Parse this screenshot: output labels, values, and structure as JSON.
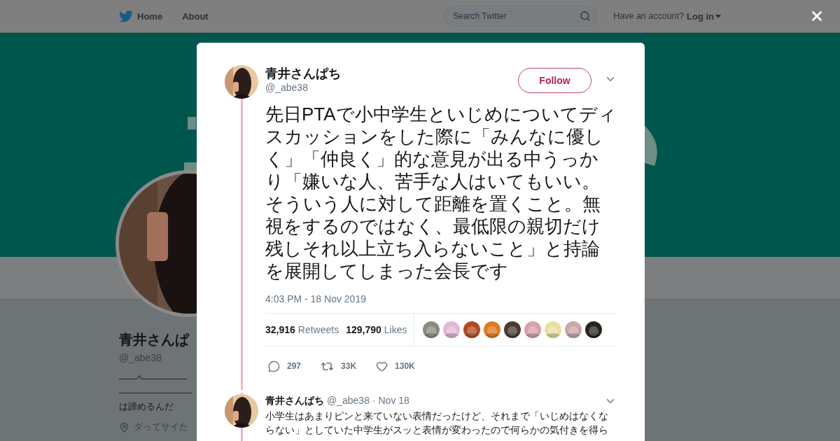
{
  "header": {
    "nav": [
      {
        "label": "Home"
      },
      {
        "label": "About"
      }
    ],
    "search": {
      "placeholder": "Search Twitter"
    },
    "account_prompt": "Have an account?",
    "login": "Log in"
  },
  "profile": {
    "name": "青井さんぱ",
    "handle": "@_abe38",
    "bio_lines": [
      "——^—————",
      "————————",
      "は諦めるんだ"
    ],
    "location": "ダってサイた"
  },
  "tweet": {
    "author": "青井さんぱち",
    "handle": "@_abe38",
    "follow": "Follow",
    "text": "先日PTAで小中学生といじめについてディスカッションをした際に「みんなに優しく」「仲良く」的な意見が出る中うっかり「嫌いな人、苦手な人はいてもいい。そういう人に対して距離を置くこと。無視をするのではなく、最低限の親切だけ残しそれ以上立ち入らないこと」と持論を展開してしまった会長です",
    "time": "4:03 PM - 18 Nov 2019",
    "stats": [
      {
        "count": "32,916",
        "label": "Retweets"
      },
      {
        "count": "129,790",
        "label": "Likes"
      }
    ],
    "actions": [
      {
        "kind": "reply",
        "count": "297"
      },
      {
        "kind": "retweet",
        "count": "33K"
      },
      {
        "kind": "like",
        "count": "130K"
      }
    ]
  },
  "reply": {
    "author": "青井さんぱち",
    "handle": "@_abe38",
    "date": "· Nov 18",
    "text": "小学生はあまりピンと来ていない表情だったけど、それまで「いじめはなくならない」としていた中学生がスッと表情が変わったので何らかの気付きを得ら"
  }
}
